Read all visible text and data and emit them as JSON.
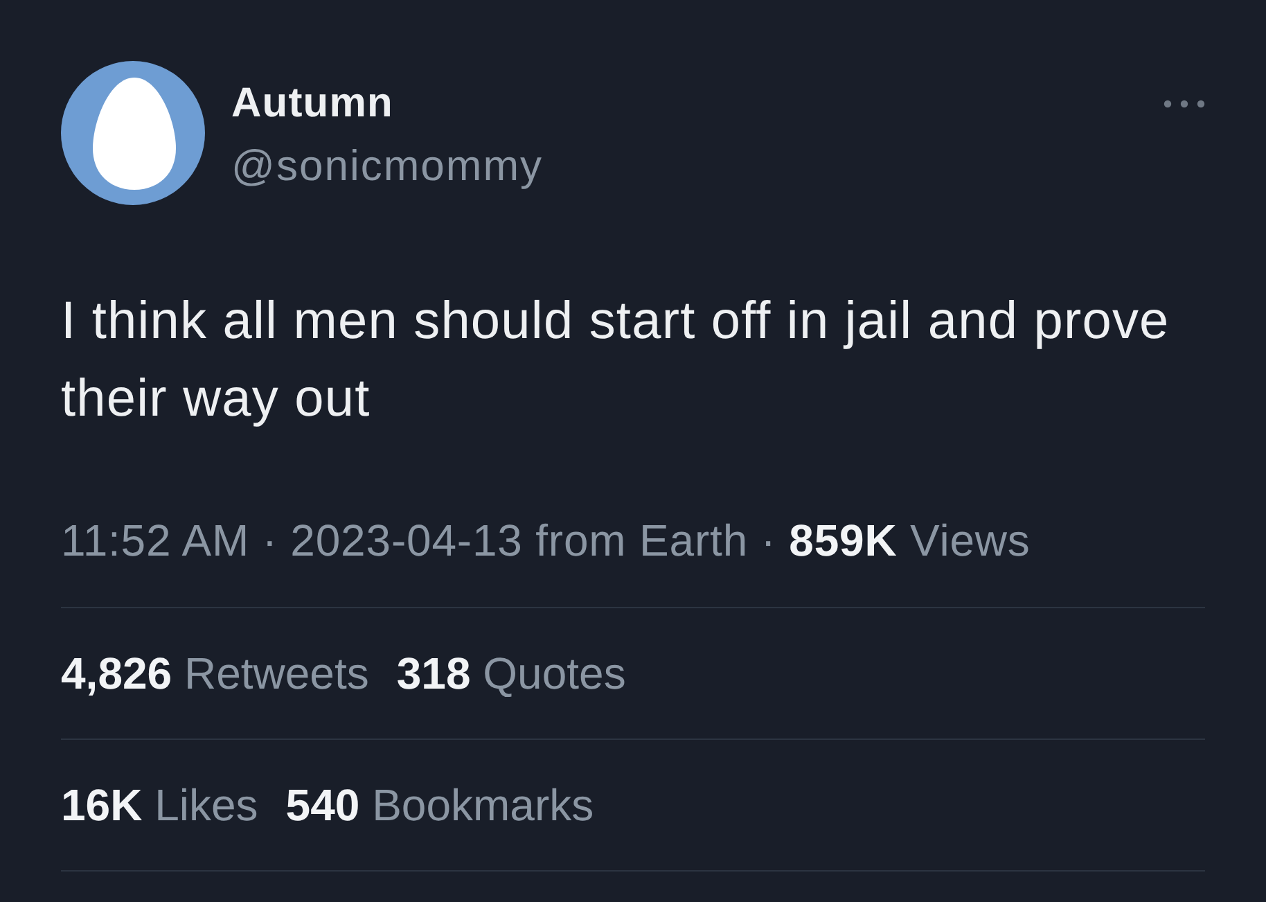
{
  "tweet": {
    "author": {
      "name": "Autumn",
      "handle": "@sonicmommy"
    },
    "text": "I think all men should start off in jail and prove their way out",
    "meta": "11:52 AM · 2023-04-13 from Earth · **859K** Views",
    "stats": [
      [
        {
          "count": "4,826",
          "label": "Retweets"
        },
        {
          "count": "318",
          "label": "Quotes"
        }
      ],
      [
        {
          "count": "16K",
          "label": "Likes"
        },
        {
          "count": "540",
          "label": "Bookmarks"
        }
      ]
    ]
  }
}
